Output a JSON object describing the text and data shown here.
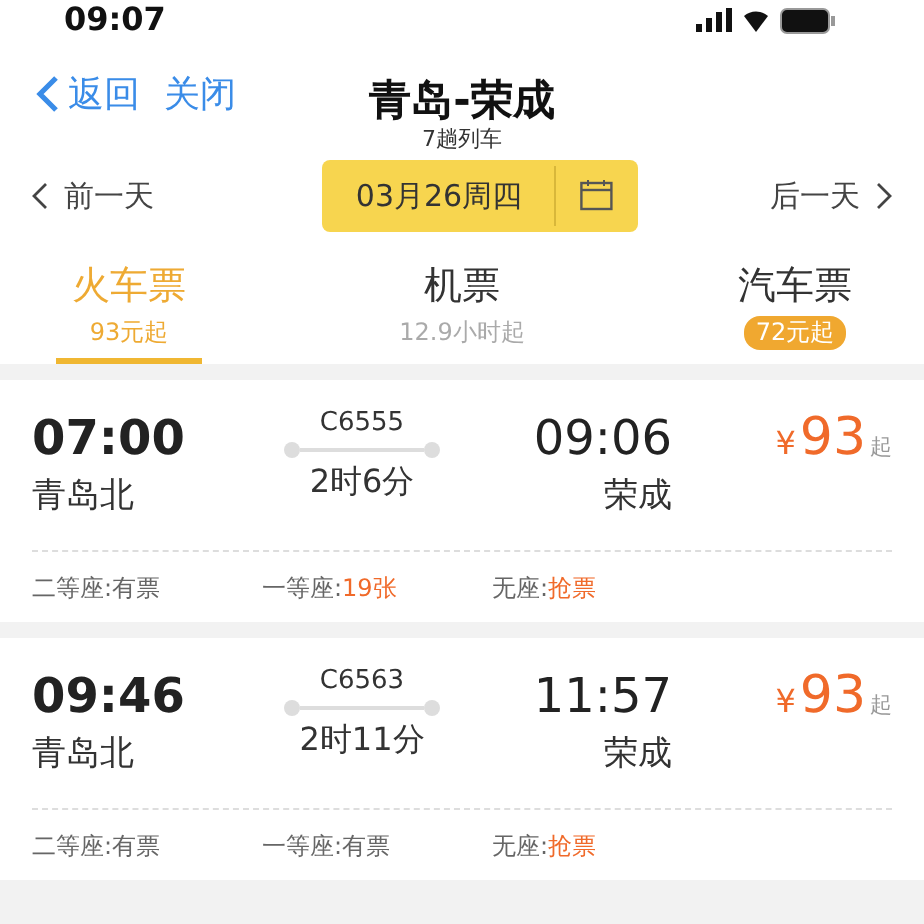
{
  "status_bar": {
    "time": "09:07"
  },
  "nav": {
    "back": "返回",
    "close": "关闭",
    "title": "青岛-荣成",
    "subtitle": "7趟列车"
  },
  "date_bar": {
    "prev": "前一天",
    "date": "03月26周四",
    "next": "后一天"
  },
  "tabs": [
    {
      "label": "火车票",
      "note": "93元起",
      "selected": true,
      "badge": false
    },
    {
      "label": "机票",
      "note": "12.9小时起",
      "selected": false,
      "badge": false
    },
    {
      "label": "汽车票",
      "note": "72元起",
      "selected": false,
      "badge": true
    }
  ],
  "trains": [
    {
      "depart_time": "07:00",
      "depart_station": "青岛北",
      "number": "C6555",
      "duration": "2时6分",
      "arrive_time": "09:06",
      "arrive_station": "荣成",
      "currency": "¥",
      "price": "93",
      "price_suffix": "起",
      "seats": [
        {
          "name": "二等座:",
          "status": "有票",
          "highlight": false
        },
        {
          "name": "一等座:",
          "status": "19张",
          "highlight": true
        },
        {
          "name": "无座:",
          "status": "抢票",
          "highlight": true
        }
      ]
    },
    {
      "depart_time": "09:46",
      "depart_station": "青岛北",
      "number": "C6563",
      "duration": "2时11分",
      "arrive_time": "11:57",
      "arrive_station": "荣成",
      "currency": "¥",
      "price": "93",
      "price_suffix": "起",
      "seats": [
        {
          "name": "二等座:",
          "status": "有票",
          "highlight": false
        },
        {
          "name": "一等座:",
          "status": "有票",
          "highlight": false
        },
        {
          "name": "无座:",
          "status": "抢票",
          "highlight": true
        }
      ]
    }
  ]
}
